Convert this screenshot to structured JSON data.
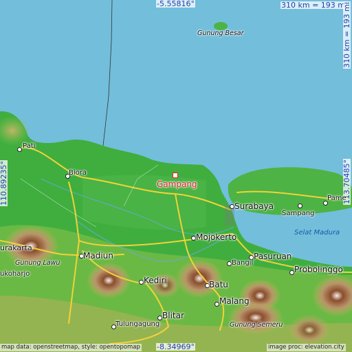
{
  "coords": {
    "top": "-5.55816°",
    "bottom": "-8.34969°",
    "left": "110.89235°",
    "right": "113.70485°",
    "scale_top": "310 km = 193 mi",
    "scale_right": "310 km = 193 mi"
  },
  "marker": {
    "label": "Gampang"
  },
  "places": {
    "gunung_besar": "Gunung Besar",
    "pati": "Pati",
    "blora": "Blora",
    "surabaya": "Surabaya",
    "pamekasan": "Pame",
    "sampang": "Sampang",
    "selat_madura": "Selat Madura",
    "surakarta": "urakarta",
    "gunung_lawu": "Gunung Lawu",
    "sukoharjo": "ukoharjo",
    "madiun": "Madiun",
    "mojokerto": "Mojokerto",
    "pasuruan": "Pasuruan",
    "bangil": "Bangil",
    "probolinggo": "Probolinggo",
    "kediri": "Kediri",
    "batu": "Batu",
    "malang": "Malang",
    "blitar": "Blitar",
    "tulungagung": "Tulungagung",
    "gunung_semeru": "Gunung Semeru"
  },
  "credits": {
    "left": "map data: openstreetmap, style: opentopomap",
    "right": "image proc: elevation.city"
  },
  "colors": {
    "sea": "#73bedb",
    "lowland": "#3fae3f",
    "upland": "#c8b060",
    "mountain": "#8a4e2e",
    "road": "#f2d23a",
    "marker": "#e8202a",
    "coord_text": "#1f3fb0"
  }
}
